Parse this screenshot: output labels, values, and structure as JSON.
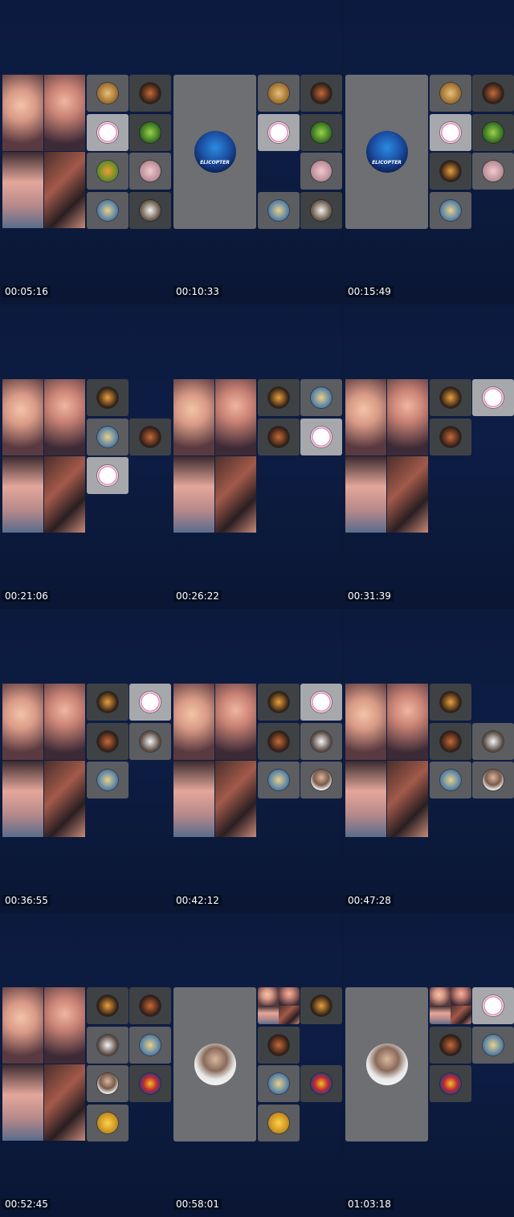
{
  "screen": {
    "title": ""
  },
  "frames": [
    {
      "timestamp": "00:05:16"
    },
    {
      "timestamp": "00:10:33"
    },
    {
      "timestamp": "00:15:49"
    },
    {
      "timestamp": "00:21:06"
    },
    {
      "timestamp": "00:26:22"
    },
    {
      "timestamp": "00:31:39"
    },
    {
      "timestamp": "00:36:55"
    },
    {
      "timestamp": "00:42:12"
    },
    {
      "timestamp": "00:47:28"
    },
    {
      "timestamp": "00:52:45"
    },
    {
      "timestamp": "00:58:01"
    },
    {
      "timestamp": "01:03:18"
    }
  ],
  "logo": {
    "elicopter_text": "ELICOPTER"
  }
}
